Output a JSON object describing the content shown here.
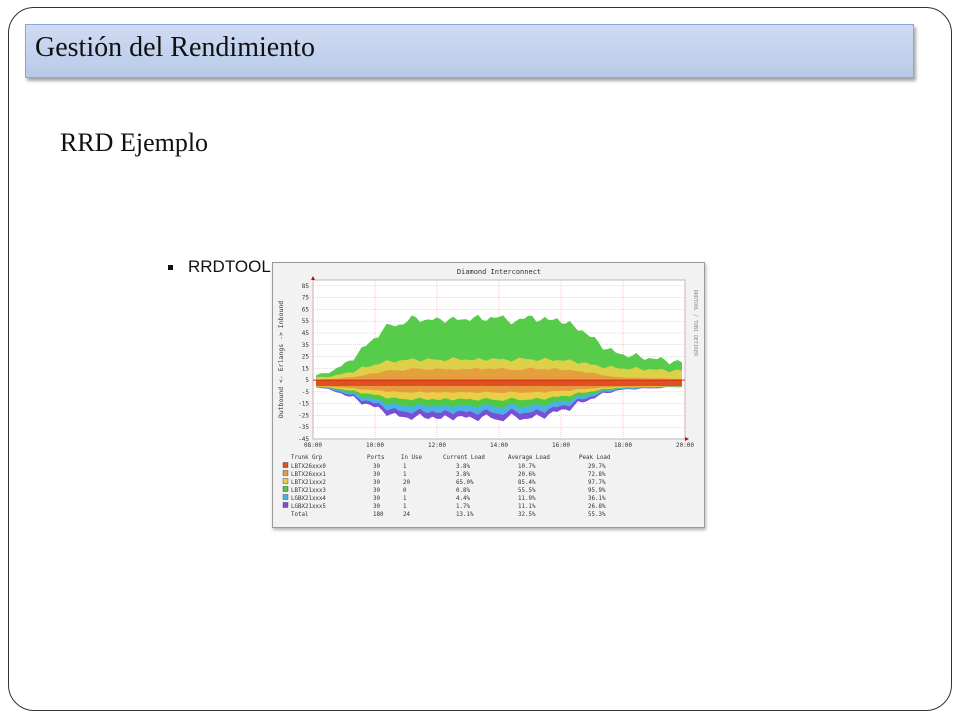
{
  "slide": {
    "title": "Gestión del Rendimiento",
    "subtitle": "RRD Ejemplo",
    "bullet": "RRDTOOL"
  },
  "colors": {
    "title_bar": "#bfcfec",
    "plot_bg": "#ffffff",
    "grid": "#e2aaaa",
    "zero_line": "#d02a16"
  },
  "chart_data": {
    "type": "area",
    "title": "Diamond Interconnect",
    "ylabel": "Outbound <- Erlangs -> Inbound",
    "side_label": "RRDTOOL / TOBI OETIKER",
    "ylim": [
      -45,
      90
    ],
    "yticks": [
      "85",
      "75",
      "65",
      "55",
      "45",
      "35",
      "25",
      "15",
      "5",
      "-5",
      "-15",
      "-25",
      "-35",
      "-45"
    ],
    "xticks": [
      "08:00",
      "10:00",
      "12:00",
      "14:00",
      "16:00",
      "18:00",
      "20:00"
    ],
    "grid": true,
    "series": [
      {
        "name": "LBTX26xxx0",
        "color": "#e05020"
      },
      {
        "name": "LBTX26xxx1",
        "color": "#e69c3e"
      },
      {
        "name": "LBTX21xxx2",
        "color": "#e6d048"
      },
      {
        "name": "LBTX21xxx3",
        "color": "#4ec941"
      },
      {
        "name": "LGBX21xxx4",
        "color": "#4ab0e6"
      },
      {
        "name": "LGBX21xxx5",
        "color": "#7a4fd4"
      }
    ],
    "inbound_total": [
      4,
      5,
      6,
      9,
      12,
      16,
      20,
      24,
      27,
      29,
      30,
      31,
      32,
      31,
      32,
      31,
      32,
      33,
      32,
      31,
      32,
      33,
      32,
      31,
      32,
      33,
      32,
      31,
      32,
      31,
      30,
      29,
      27,
      24,
      22,
      20,
      19,
      18,
      18,
      17,
      17,
      16,
      15,
      15,
      14
    ],
    "inbound_peaks": [
      0,
      1,
      2,
      3,
      5,
      7,
      10,
      13,
      17,
      20,
      19,
      21,
      24,
      22,
      21,
      23,
      22,
      20,
      22,
      25,
      21,
      23,
      24,
      22,
      20,
      21,
      25,
      22,
      21,
      24,
      20,
      19,
      17,
      14,
      11,
      7,
      5,
      4,
      3,
      3,
      2,
      2,
      2,
      1,
      1
    ],
    "outbound_total": [
      -1,
      -2,
      -4,
      -6,
      -9,
      -12,
      -15,
      -18,
      -21,
      -24,
      -26,
      -27,
      -26,
      -27,
      -26,
      -28,
      -27,
      -26,
      -27,
      -28,
      -26,
      -27,
      -29,
      -27,
      -26,
      -28,
      -27,
      -26,
      -24,
      -22,
      -20,
      -17,
      -14,
      -11,
      -8,
      -6,
      -4,
      -3,
      -3,
      -2,
      -2,
      -2,
      -1,
      -1,
      -1
    ],
    "table": {
      "headers": [
        "Trunk Grp",
        "Ports",
        "In Use",
        "Current Load",
        "Average Load",
        "Peak Load"
      ],
      "rows": [
        [
          "LBTX26xxx0",
          "30",
          "1",
          "3.8%",
          "10.7%",
          "29.7%"
        ],
        [
          "LBTX26xxx1",
          "30",
          "1",
          "3.8%",
          "20.6%",
          "72.8%"
        ],
        [
          "LBTX21xxx2",
          "30",
          "20",
          "65.0%",
          "85.4%",
          "97.7%"
        ],
        [
          "LBTX21xxx3",
          "30",
          "0",
          "0.8%",
          "55.5%",
          "95.9%"
        ],
        [
          "LGBX21xxx4",
          "30",
          "1",
          "4.4%",
          "11.9%",
          "36.1%"
        ],
        [
          "LGBX21xxx5",
          "30",
          "1",
          "1.7%",
          "11.1%",
          "26.8%"
        ],
        [
          "Total",
          "180",
          "24",
          "13.1%",
          "32.5%",
          "55.3%"
        ]
      ]
    }
  }
}
